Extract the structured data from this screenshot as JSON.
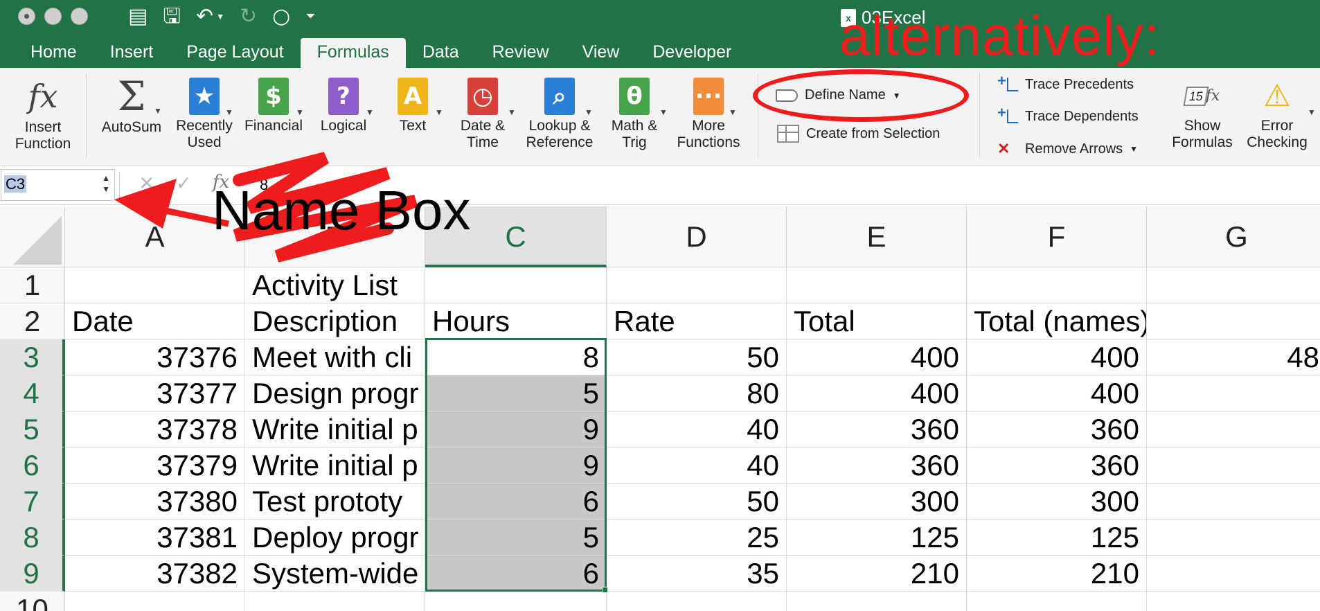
{
  "window": {
    "title": "03Excel",
    "file_icon_letter": "x"
  },
  "ribbon_tabs": [
    "Home",
    "Insert",
    "Page Layout",
    "Formulas",
    "Data",
    "Review",
    "View",
    "Developer"
  ],
  "active_tab": "Formulas",
  "ribbon": {
    "insert_function": "Insert\nFunction",
    "autosum": "AutoSum",
    "recently_used": "Recently\nUsed",
    "financial": "Financial",
    "logical": "Logical",
    "text": "Text",
    "date_time": "Date &\nTime",
    "lookup_reference": "Lookup &\nReference",
    "math_trig": "Math &\nTrig",
    "more_functions": "More\nFunctions",
    "define_name": "Define Name",
    "create_from_selection": "Create from Selection",
    "trace_precedents": "Trace Precedents",
    "trace_dependents": "Trace Dependents",
    "remove_arrows": "Remove Arrows",
    "show_formulas": "Show\nFormulas",
    "error_checking": "Error\nChecking",
    "show_formulas_icon_text": "15"
  },
  "formula_bar": {
    "name_box": "C3",
    "value": "8"
  },
  "columns": [
    "A",
    "B",
    "C",
    "D",
    "E",
    "F",
    "G"
  ],
  "rows": [
    {
      "n": "1",
      "cells": [
        "",
        "Activity List",
        "",
        "",
        "",
        "",
        ""
      ]
    },
    {
      "n": "2",
      "cells": [
        "Date",
        "Description",
        "Hours",
        "Rate",
        "Total",
        "Total (names)",
        ""
      ]
    },
    {
      "n": "3",
      "cells": [
        "37376",
        "Meet with cli",
        "8",
        "50",
        "400",
        "400",
        "48"
      ]
    },
    {
      "n": "4",
      "cells": [
        "37377",
        "Design progr",
        "5",
        "80",
        "400",
        "400",
        ""
      ]
    },
    {
      "n": "5",
      "cells": [
        "37378",
        "Write initial p",
        "9",
        "40",
        "360",
        "360",
        ""
      ]
    },
    {
      "n": "6",
      "cells": [
        "37379",
        "Write initial p",
        "9",
        "40",
        "360",
        "360",
        ""
      ]
    },
    {
      "n": "7",
      "cells": [
        "37380",
        "Test prototy",
        "6",
        "50",
        "300",
        "300",
        ""
      ]
    },
    {
      "n": "8",
      "cells": [
        "37381",
        "Deploy progr",
        "5",
        "25",
        "125",
        "125",
        ""
      ]
    },
    {
      "n": "9",
      "cells": [
        "37382",
        "System-wide",
        "6",
        "35",
        "210",
        "210",
        ""
      ]
    },
    {
      "n": "10",
      "cells": [
        "",
        "",
        "",
        "",
        "",
        "",
        ""
      ]
    }
  ],
  "annotations": {
    "name_box_label": "Name Box",
    "alternatively_label": "alternatively:",
    "color": "#ee1c1c"
  },
  "colors": {
    "excel_green": "#217346",
    "selection_fill": "#c8c8c8"
  }
}
